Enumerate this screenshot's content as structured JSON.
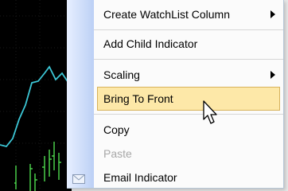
{
  "menu": {
    "items": [
      {
        "label": "Create WatchList Column",
        "has_submenu": true
      },
      {
        "label": "Add Child Indicator",
        "has_submenu": false
      },
      {
        "label": "Scaling",
        "has_submenu": true
      },
      {
        "label": "Bring To Front",
        "has_submenu": false,
        "highlighted": true
      },
      {
        "label": "Copy",
        "has_submenu": false
      },
      {
        "label": "Paste",
        "has_submenu": false,
        "disabled": true
      },
      {
        "label": "Email Indicator",
        "has_submenu": false
      }
    ]
  },
  "icons": {
    "email_indicator": "envelope-icon",
    "submenu_arrow": "chevron-right-icon",
    "cursor": "mouse-pointer-icon"
  },
  "colors": {
    "highlight_fill": "#fde8a8",
    "highlight_border": "#d7b25a",
    "chart_background": "#000000",
    "chart_line": "#3cc7d6",
    "chart_bars": "#4fdc4f"
  }
}
